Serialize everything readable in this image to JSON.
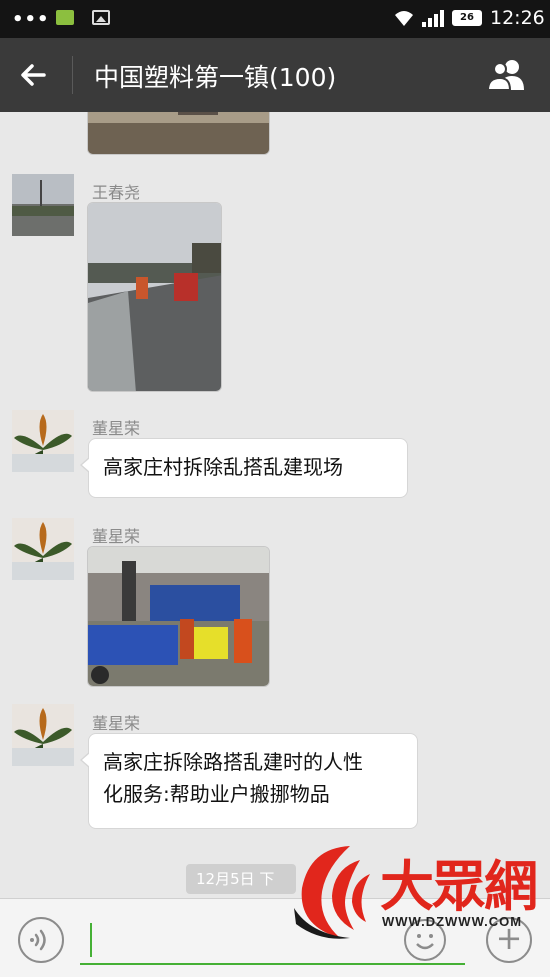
{
  "status_bar": {
    "dots": "•••",
    "battery": "26",
    "time": "12:26"
  },
  "header": {
    "title": "中国塑料第一镇(100)",
    "back_icon": "arrow-left-icon",
    "members_icon": "group-members-icon"
  },
  "messages": [
    {
      "type": "image",
      "sender": "",
      "description_icon": "road-photo"
    },
    {
      "type": "image",
      "sender": "王春尧"
    },
    {
      "type": "text",
      "sender": "董星荣",
      "text": "高家庄村拆除乱搭乱建现场"
    },
    {
      "type": "image",
      "sender": "董星荣"
    },
    {
      "type": "text",
      "sender": "董星荣",
      "text_line1": "高家庄拆除路搭乱建时的人性",
      "text_line2": "化服务:帮助业户搬挪物品"
    }
  ],
  "time_badge": "12月5日 下",
  "watermark": {
    "name": "大眾網",
    "url": "WWW.DZWWW.COM"
  },
  "input_bar": {
    "voice_icon": "voice-icon",
    "emoji_icon": "emoji-icon",
    "plus_icon": "plus-icon",
    "plus_glyph": "+"
  },
  "colors": {
    "header_bg": "#3a3a3a",
    "chat_bg": "#e8e8e8",
    "accent_green": "#45b035",
    "watermark_red": "#e1261c"
  }
}
